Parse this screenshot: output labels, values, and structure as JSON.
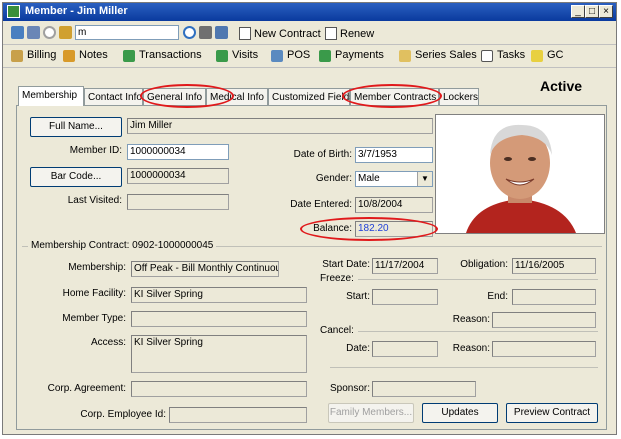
{
  "window": {
    "title": "Member - Jim Miller"
  },
  "toolbar1": {
    "search_value": "m",
    "new_contract_label": "New Contract",
    "renew_label": "Renew"
  },
  "toolbar2": {
    "items": [
      "Billing",
      "Notes",
      "Transactions",
      "Visits",
      "POS",
      "Payments",
      "Series Sales",
      "Tasks",
      "GC"
    ]
  },
  "status": "Active",
  "tabs": [
    "Membership",
    "Contact Info",
    "General Info",
    "Medical Info",
    "Customized Fields",
    "Member Contracts",
    "Lockers"
  ],
  "member": {
    "full_name_button": "Full Name...",
    "full_name": "Jim Miller",
    "member_id_label": "Member ID:",
    "member_id": "1000000034",
    "bar_code_button": "Bar Code...",
    "bar_code": "1000000034",
    "last_visited_label": "Last Visited:",
    "last_visited": "",
    "dob_label": "Date of Birth:",
    "dob": "3/7/1953",
    "gender_label": "Gender:",
    "gender": "Male",
    "date_entered_label": "Date Entered:",
    "date_entered": "10/8/2004",
    "balance_label": "Balance:",
    "balance": "182.20"
  },
  "contract": {
    "group_title": "Membership Contract: 0902-1000000045",
    "membership_label": "Membership:",
    "membership": "Off Peak - Bill Monthly Continuou",
    "home_facility_label": "Home Facility:",
    "home_facility": "KI Silver Spring",
    "member_type_label": "Member Type:",
    "member_type": "",
    "access_label": "Access:",
    "access": "KI Silver Spring",
    "corp_agreement_label": "Corp. Agreement:",
    "corp_agreement": "",
    "corp_employee_label": "Corp. Employee Id:",
    "corp_employee": "",
    "start_date_label": "Start Date:",
    "start_date": "11/17/2004",
    "obligation_label": "Obligation:",
    "obligation": "11/16/2005",
    "freeze_label": "Freeze:",
    "start_label": "Start:",
    "end_label": "End:",
    "reason_label": "Reason:",
    "cancel_label": "Cancel:",
    "date_label": "Date:",
    "reason2_label": "Reason:",
    "sponsor_label": "Sponsor:",
    "family_members_button": "Family Members...",
    "updates_button": "Updates",
    "preview_contract_button": "Preview Contract"
  },
  "colors": {
    "balance": "#1f3fd8",
    "highlight_oval": "#e0191b",
    "titlebar": "#0a3a9e"
  }
}
